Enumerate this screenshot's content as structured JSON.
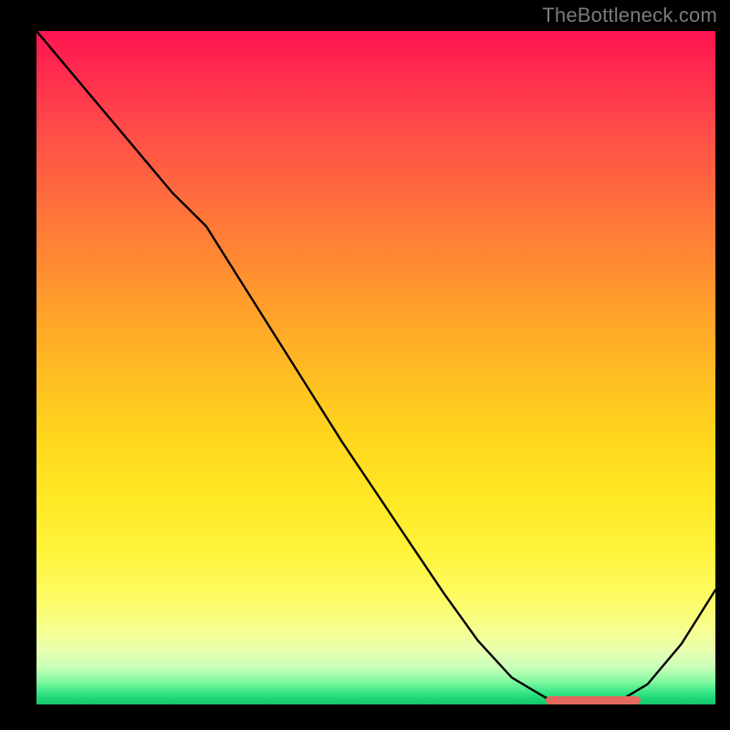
{
  "attribution": "TheBottleneck.com",
  "colors": {
    "gradient_top": "#ff1450",
    "gradient_mid": "#ffd51e",
    "gradient_bottom": "#13c46a",
    "curve_stroke": "#000000",
    "marker_fill": "#e5695e",
    "page_bg": "#000000"
  },
  "chart_data": {
    "type": "line",
    "title": "",
    "xlabel": "",
    "ylabel": "",
    "xlim": [
      0,
      100
    ],
    "ylim": [
      0,
      100
    ],
    "series": [
      {
        "name": "bottleneck-curve",
        "x": [
          0,
          5,
          10,
          15,
          20,
          25,
          30,
          35,
          40,
          45,
          50,
          55,
          60,
          65,
          70,
          75,
          80,
          85,
          90,
          95,
          100
        ],
        "values": [
          100,
          94,
          88,
          82,
          76,
          71,
          63,
          55,
          47,
          39,
          31.5,
          24,
          16.5,
          9.5,
          4,
          1,
          0,
          0,
          3,
          9,
          17
        ]
      }
    ],
    "marker": {
      "name": "optimal-band",
      "x_start": 75,
      "x_end": 89,
      "y": 0.6
    },
    "background_gradient": {
      "orientation": "vertical",
      "stops": [
        {
          "pos": 0.0,
          "color": "#ff1450"
        },
        {
          "pos": 0.25,
          "color": "#ff6a3e"
        },
        {
          "pos": 0.5,
          "color": "#ffbd22"
        },
        {
          "pos": 0.78,
          "color": "#fff33a"
        },
        {
          "pos": 0.93,
          "color": "#c7ffb9"
        },
        {
          "pos": 1.0,
          "color": "#13c46a"
        }
      ]
    }
  }
}
